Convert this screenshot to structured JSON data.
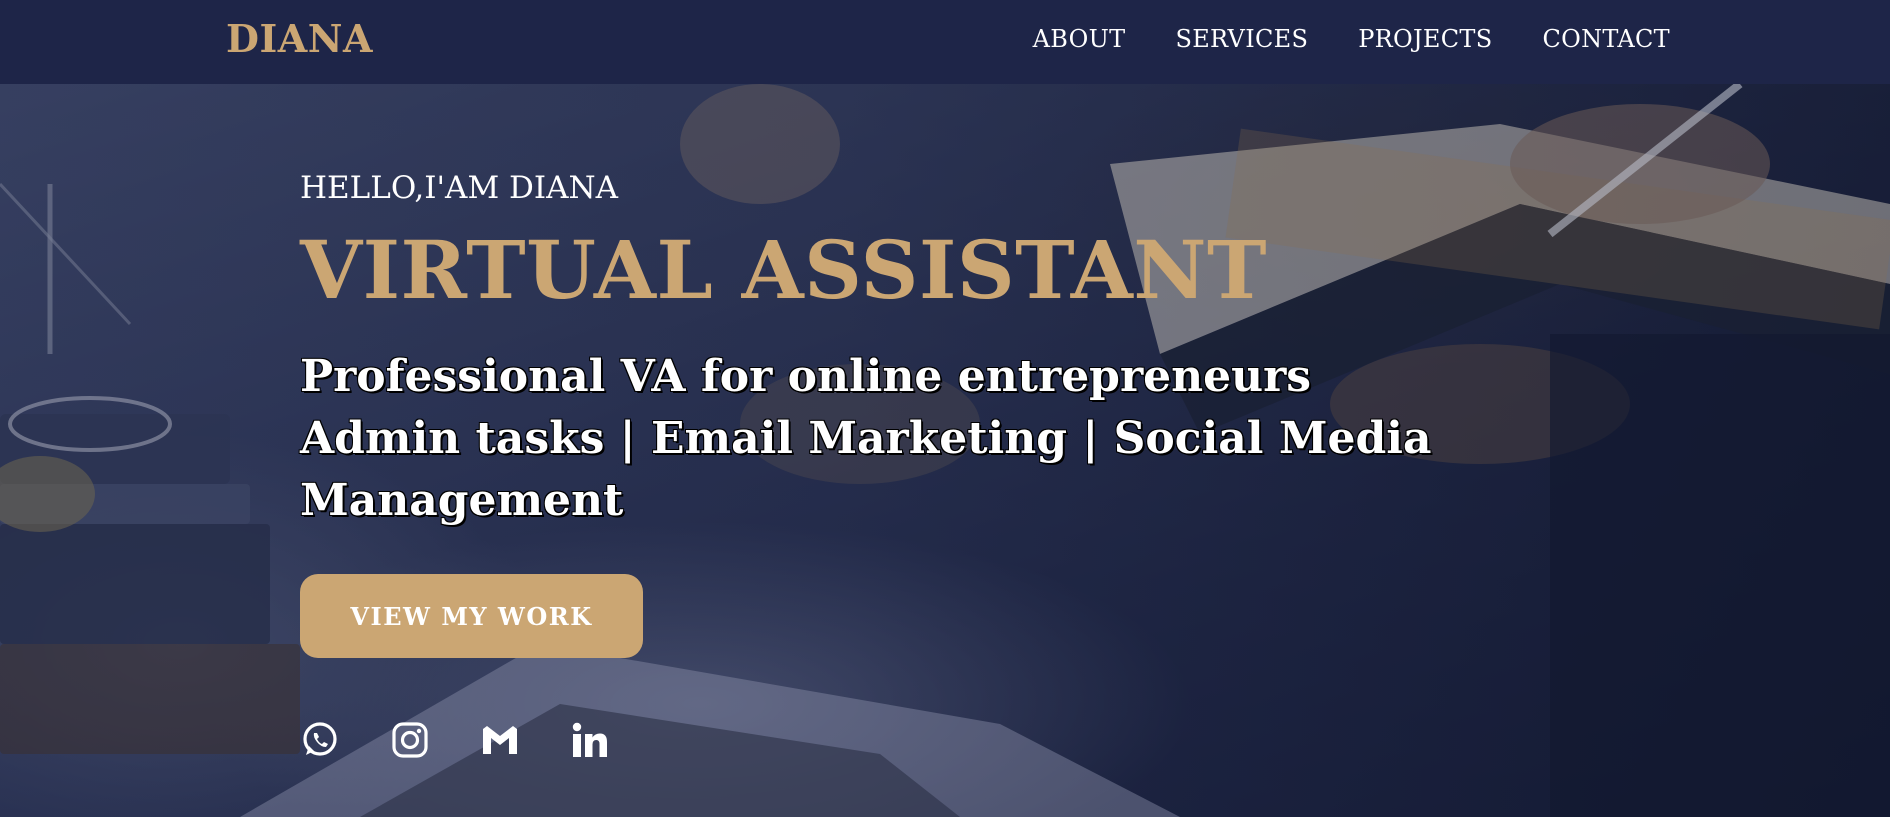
{
  "brand": {
    "name": "DIANA",
    "accent_color": "#cba673",
    "nav_background": "#1e2548"
  },
  "nav": {
    "links": [
      {
        "label": "ABOUT"
      },
      {
        "label": "SERVICES"
      },
      {
        "label": "PROJECTS"
      },
      {
        "label": "CONTACT"
      }
    ]
  },
  "hero": {
    "greeting": "HELLO,I'AM DIANA",
    "title": "VIRTUAL ASSISTANT",
    "tagline_lines": [
      "Professional VA for online entrepreneurs",
      "Admin tasks | Email Marketing | Social Media",
      "Management"
    ],
    "cta_label": "VIEW MY WORK",
    "background_image": "business people reviewing documents and books at a desk with a laptop, dark blue overlay"
  },
  "socials": [
    {
      "icon": "whatsapp-icon"
    },
    {
      "icon": "instagram-icon"
    },
    {
      "icon": "gmail-icon"
    },
    {
      "icon": "linkedin-icon"
    }
  ]
}
